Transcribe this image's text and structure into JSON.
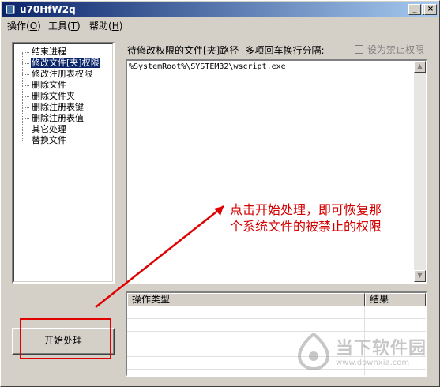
{
  "window": {
    "title": "u70HfW2q"
  },
  "menu": [
    {
      "label": "操作(",
      "key": "O",
      "suffix": ")"
    },
    {
      "label": "工具(",
      "key": "T",
      "suffix": ")"
    },
    {
      "label": "帮助(",
      "key": "H",
      "suffix": ")"
    }
  ],
  "tree": {
    "items": [
      {
        "label": "结束进程",
        "selected": false
      },
      {
        "label": "修改文件[夹]权限",
        "selected": true
      },
      {
        "label": "修改注册表权限",
        "selected": false
      },
      {
        "label": "删除文件",
        "selected": false
      },
      {
        "label": "删除文件夹",
        "selected": false
      },
      {
        "label": "删除注册表键",
        "selected": false
      },
      {
        "label": "删除注册表值",
        "selected": false
      },
      {
        "label": "其它处理",
        "selected": false
      },
      {
        "label": "替换文件",
        "selected": false
      }
    ]
  },
  "main": {
    "path_label": "待修改权限的文件[夹]路径 -多项回车换行分隔:",
    "forbid_checkbox_label": "设为禁止权限",
    "path_value": "%SystemRoot%\\SYSTEM32\\wscript.exe"
  },
  "result_list": {
    "columns": [
      "操作类型",
      "结果"
    ]
  },
  "actions": {
    "start_label": "开始处理"
  },
  "annotation": {
    "text": "点击开始处理，即可恢复那个系统文件的被禁止的权限"
  },
  "watermark": {
    "name": "当下软件园",
    "url": "www.downxia.com"
  },
  "colors": {
    "titlebar": "#0a246a",
    "selection": "#0a246a",
    "annotation": "#d40000",
    "highlight_box": "#e00000"
  }
}
